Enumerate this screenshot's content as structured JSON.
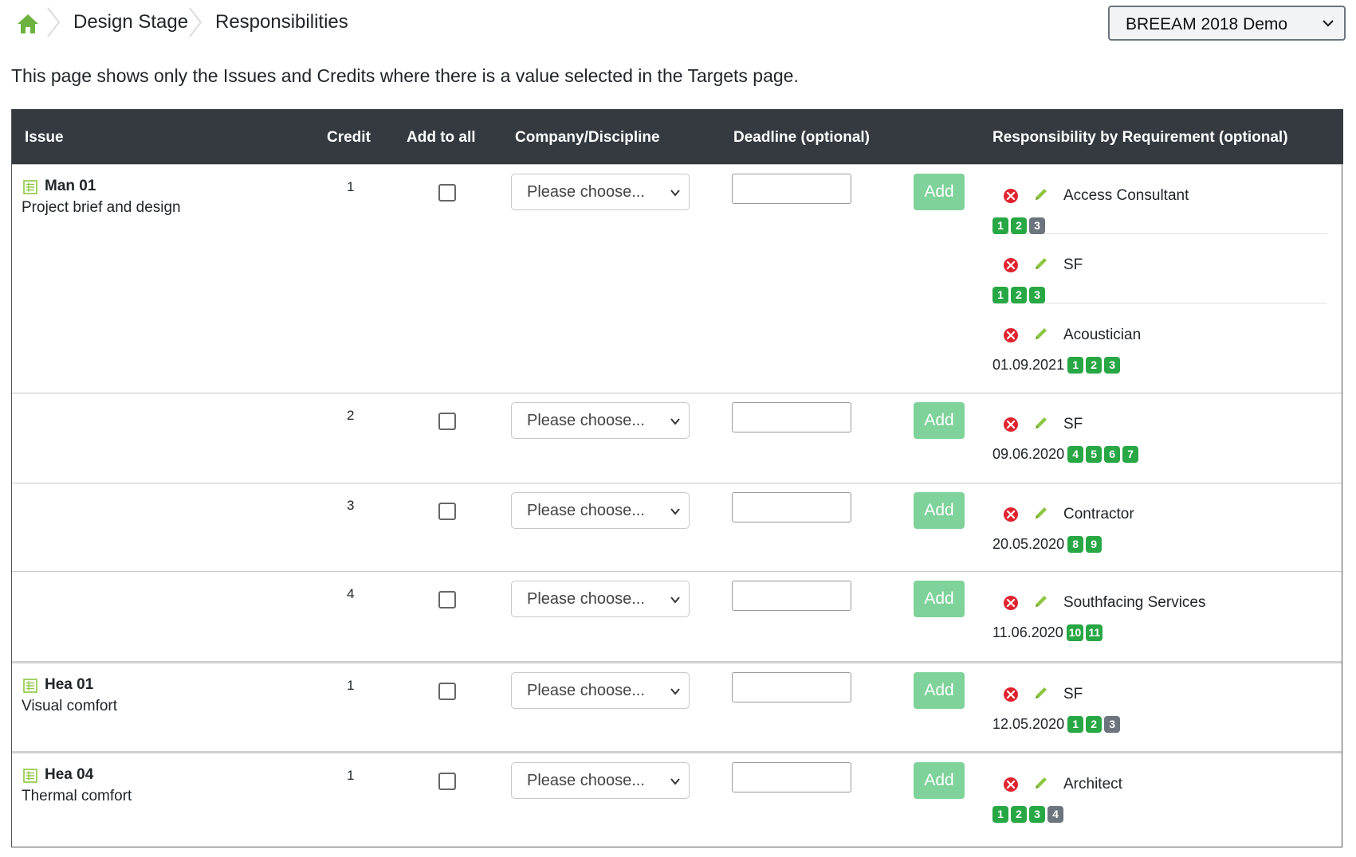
{
  "breadcrumb": {
    "items": [
      "Design Stage",
      "Responsibilities"
    ]
  },
  "project_selector": {
    "value": "BREEAM 2018 Demo"
  },
  "intro_text": "This page shows only the Issues and Credits where there is a value selected in the Targets page.",
  "table": {
    "headers": {
      "issue": "Issue",
      "credit": "Credit",
      "add_to_all": "Add to all",
      "company": "Company/Discipline",
      "deadline": "Deadline (optional)",
      "responsibility": "Responsibility by Requirement (optional)"
    },
    "choose_placeholder": "Please choose...",
    "add_label": "Add",
    "rows": [
      {
        "issue_code": "Man 01",
        "issue_name": "Project brief and design",
        "credit": "1",
        "responsibilities": [
          {
            "name": "Access Consultant",
            "date": "",
            "badges": [
              {
                "n": "1",
                "s": "green"
              },
              {
                "n": "2",
                "s": "green"
              },
              {
                "n": "3",
                "s": "gray"
              }
            ]
          },
          {
            "name": "SF",
            "date": "",
            "badges": [
              {
                "n": "1",
                "s": "green"
              },
              {
                "n": "2",
                "s": "green"
              },
              {
                "n": "3",
                "s": "green"
              }
            ]
          },
          {
            "name": "Acoustician",
            "date": "01.09.2021",
            "badges": [
              {
                "n": "1",
                "s": "green"
              },
              {
                "n": "2",
                "s": "green"
              },
              {
                "n": "3",
                "s": "green"
              }
            ]
          }
        ]
      },
      {
        "issue_code": "",
        "issue_name": "",
        "credit": "2",
        "responsibilities": [
          {
            "name": "SF",
            "date": "09.06.2020",
            "badges": [
              {
                "n": "4",
                "s": "green"
              },
              {
                "n": "5",
                "s": "green"
              },
              {
                "n": "6",
                "s": "green"
              },
              {
                "n": "7",
                "s": "green"
              }
            ]
          }
        ]
      },
      {
        "issue_code": "",
        "issue_name": "",
        "credit": "3",
        "responsibilities": [
          {
            "name": "Contractor",
            "date": "20.05.2020",
            "badges": [
              {
                "n": "8",
                "s": "green"
              },
              {
                "n": "9",
                "s": "green"
              }
            ]
          }
        ]
      },
      {
        "issue_code": "",
        "issue_name": "",
        "credit": "4",
        "responsibilities": [
          {
            "name": "Southfacing Services",
            "date": "11.06.2020",
            "badges": [
              {
                "n": "10",
                "s": "green"
              },
              {
                "n": "11",
                "s": "green"
              }
            ]
          }
        ]
      },
      {
        "issue_code": "Hea 01",
        "issue_name": "Visual comfort",
        "credit": "1",
        "responsibilities": [
          {
            "name": "SF",
            "date": "12.05.2020",
            "badges": [
              {
                "n": "1",
                "s": "green"
              },
              {
                "n": "2",
                "s": "green"
              },
              {
                "n": "3",
                "s": "gray"
              }
            ]
          }
        ]
      },
      {
        "issue_code": "Hea 04",
        "issue_name": "Thermal comfort",
        "credit": "1",
        "responsibilities": [
          {
            "name": "Architect",
            "date": "",
            "badges": [
              {
                "n": "1",
                "s": "green"
              },
              {
                "n": "2",
                "s": "green"
              },
              {
                "n": "3",
                "s": "green"
              },
              {
                "n": "4",
                "s": "gray"
              }
            ]
          }
        ]
      }
    ]
  },
  "colors": {
    "accent_green": "#28a745",
    "header_bg": "#343a40",
    "add_button": "#7ed29a",
    "remove_red": "#e0242f",
    "edit_green": "#8cc63f",
    "home_green": "#6cb33f"
  }
}
